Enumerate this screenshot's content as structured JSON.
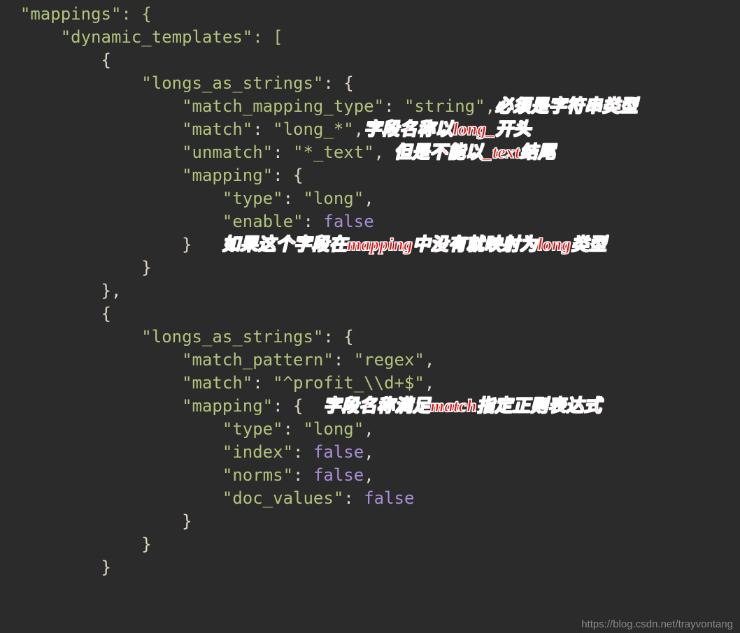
{
  "code": {
    "l1": "  \"mappings\": {",
    "l2": "      \"dynamic_templates\": [",
    "l3": "          {",
    "l4a": "              \"longs_as_strings\"",
    "l4b": ": {",
    "l5a": "                  \"match_mapping_type\"",
    "l5b": ": ",
    "l5c": "\"string\"",
    "l5d": ",",
    "l6a": "                  \"match\"",
    "l6b": ": ",
    "l6c": "\"long_*\"",
    "l6d": ",",
    "l7a": "                  \"unmatch\"",
    "l7b": ": ",
    "l7c": "\"*_text\"",
    "l7d": ", ",
    "l8a": "                  \"mapping\"",
    "l8b": ": {",
    "l9a": "                      \"type\"",
    "l9b": ": ",
    "l9c": "\"long\"",
    "l9d": ",",
    "l10a": "                      \"enable\"",
    "l10b": ": ",
    "l10c": "false",
    "l11": "                  }   ",
    "l12": "              }",
    "l13": "          },",
    "l14": "          {",
    "l15a": "              \"longs_as_strings\"",
    "l15b": ": {",
    "l16a": "                  \"match_pattern\"",
    "l16b": ": ",
    "l16c": "\"regex\"",
    "l16d": ",",
    "l17a": "                  \"match\"",
    "l17b": ": ",
    "l17c": "\"^profit_\\\\d+$\"",
    "l17d": ",",
    "l18a": "                  \"mapping\"",
    "l18b": ": {  ",
    "l19a": "                      \"type\"",
    "l19b": ": ",
    "l19c": "\"long\"",
    "l19d": ",",
    "l20a": "                      \"index\"",
    "l20b": ": ",
    "l20c": "false",
    "l20d": ",",
    "l21a": "                      \"norms\"",
    "l21b": ": ",
    "l21c": "false",
    "l21d": ",",
    "l22a": "                      \"doc_values\"",
    "l22b": ": ",
    "l22c": "false",
    "l23": "                  }",
    "l24": "              }",
    "l25": "          }"
  },
  "annotations": {
    "a1": "必须是字符串类型",
    "a2": "字段名称以long_开头",
    "a3": "但是不能以_text结尾",
    "a4": "如果这个字段在mapping中没有就映射为long类型",
    "a5": "字段名称满足match指定正则表达式"
  },
  "watermark": "https://blog.csdn.net/trayvontang"
}
